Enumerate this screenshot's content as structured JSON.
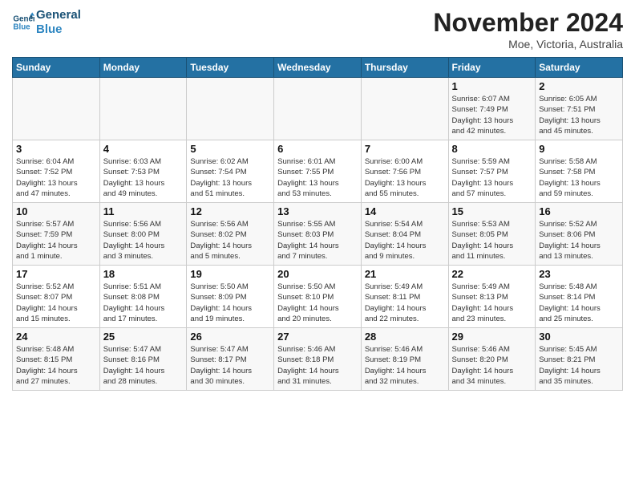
{
  "header": {
    "logo_line1": "General",
    "logo_line2": "Blue",
    "month": "November 2024",
    "location": "Moe, Victoria, Australia"
  },
  "days_of_week": [
    "Sunday",
    "Monday",
    "Tuesday",
    "Wednesday",
    "Thursday",
    "Friday",
    "Saturday"
  ],
  "weeks": [
    [
      {
        "day": "",
        "info": ""
      },
      {
        "day": "",
        "info": ""
      },
      {
        "day": "",
        "info": ""
      },
      {
        "day": "",
        "info": ""
      },
      {
        "day": "",
        "info": ""
      },
      {
        "day": "1",
        "info": "Sunrise: 6:07 AM\nSunset: 7:49 PM\nDaylight: 13 hours\nand 42 minutes."
      },
      {
        "day": "2",
        "info": "Sunrise: 6:05 AM\nSunset: 7:51 PM\nDaylight: 13 hours\nand 45 minutes."
      }
    ],
    [
      {
        "day": "3",
        "info": "Sunrise: 6:04 AM\nSunset: 7:52 PM\nDaylight: 13 hours\nand 47 minutes."
      },
      {
        "day": "4",
        "info": "Sunrise: 6:03 AM\nSunset: 7:53 PM\nDaylight: 13 hours\nand 49 minutes."
      },
      {
        "day": "5",
        "info": "Sunrise: 6:02 AM\nSunset: 7:54 PM\nDaylight: 13 hours\nand 51 minutes."
      },
      {
        "day": "6",
        "info": "Sunrise: 6:01 AM\nSunset: 7:55 PM\nDaylight: 13 hours\nand 53 minutes."
      },
      {
        "day": "7",
        "info": "Sunrise: 6:00 AM\nSunset: 7:56 PM\nDaylight: 13 hours\nand 55 minutes."
      },
      {
        "day": "8",
        "info": "Sunrise: 5:59 AM\nSunset: 7:57 PM\nDaylight: 13 hours\nand 57 minutes."
      },
      {
        "day": "9",
        "info": "Sunrise: 5:58 AM\nSunset: 7:58 PM\nDaylight: 13 hours\nand 59 minutes."
      }
    ],
    [
      {
        "day": "10",
        "info": "Sunrise: 5:57 AM\nSunset: 7:59 PM\nDaylight: 14 hours\nand 1 minute."
      },
      {
        "day": "11",
        "info": "Sunrise: 5:56 AM\nSunset: 8:00 PM\nDaylight: 14 hours\nand 3 minutes."
      },
      {
        "day": "12",
        "info": "Sunrise: 5:56 AM\nSunset: 8:02 PM\nDaylight: 14 hours\nand 5 minutes."
      },
      {
        "day": "13",
        "info": "Sunrise: 5:55 AM\nSunset: 8:03 PM\nDaylight: 14 hours\nand 7 minutes."
      },
      {
        "day": "14",
        "info": "Sunrise: 5:54 AM\nSunset: 8:04 PM\nDaylight: 14 hours\nand 9 minutes."
      },
      {
        "day": "15",
        "info": "Sunrise: 5:53 AM\nSunset: 8:05 PM\nDaylight: 14 hours\nand 11 minutes."
      },
      {
        "day": "16",
        "info": "Sunrise: 5:52 AM\nSunset: 8:06 PM\nDaylight: 14 hours\nand 13 minutes."
      }
    ],
    [
      {
        "day": "17",
        "info": "Sunrise: 5:52 AM\nSunset: 8:07 PM\nDaylight: 14 hours\nand 15 minutes."
      },
      {
        "day": "18",
        "info": "Sunrise: 5:51 AM\nSunset: 8:08 PM\nDaylight: 14 hours\nand 17 minutes."
      },
      {
        "day": "19",
        "info": "Sunrise: 5:50 AM\nSunset: 8:09 PM\nDaylight: 14 hours\nand 19 minutes."
      },
      {
        "day": "20",
        "info": "Sunrise: 5:50 AM\nSunset: 8:10 PM\nDaylight: 14 hours\nand 20 minutes."
      },
      {
        "day": "21",
        "info": "Sunrise: 5:49 AM\nSunset: 8:11 PM\nDaylight: 14 hours\nand 22 minutes."
      },
      {
        "day": "22",
        "info": "Sunrise: 5:49 AM\nSunset: 8:13 PM\nDaylight: 14 hours\nand 23 minutes."
      },
      {
        "day": "23",
        "info": "Sunrise: 5:48 AM\nSunset: 8:14 PM\nDaylight: 14 hours\nand 25 minutes."
      }
    ],
    [
      {
        "day": "24",
        "info": "Sunrise: 5:48 AM\nSunset: 8:15 PM\nDaylight: 14 hours\nand 27 minutes."
      },
      {
        "day": "25",
        "info": "Sunrise: 5:47 AM\nSunset: 8:16 PM\nDaylight: 14 hours\nand 28 minutes."
      },
      {
        "day": "26",
        "info": "Sunrise: 5:47 AM\nSunset: 8:17 PM\nDaylight: 14 hours\nand 30 minutes."
      },
      {
        "day": "27",
        "info": "Sunrise: 5:46 AM\nSunset: 8:18 PM\nDaylight: 14 hours\nand 31 minutes."
      },
      {
        "day": "28",
        "info": "Sunrise: 5:46 AM\nSunset: 8:19 PM\nDaylight: 14 hours\nand 32 minutes."
      },
      {
        "day": "29",
        "info": "Sunrise: 5:46 AM\nSunset: 8:20 PM\nDaylight: 14 hours\nand 34 minutes."
      },
      {
        "day": "30",
        "info": "Sunrise: 5:45 AM\nSunset: 8:21 PM\nDaylight: 14 hours\nand 35 minutes."
      }
    ]
  ]
}
